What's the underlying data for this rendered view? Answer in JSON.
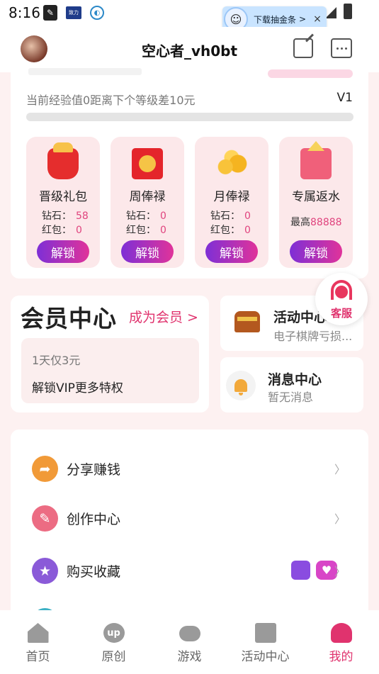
{
  "status_bar": {
    "time": "8:16",
    "app_icon_text": "致力"
  },
  "download_banner": {
    "text": "下载抽金条",
    "arrow": ">",
    "close": "×"
  },
  "header": {
    "username": "空心者_vh0bt"
  },
  "level": {
    "exp_text": "当前经验值0距离下个等级差10元",
    "level_tag": "V1",
    "progress": 0
  },
  "benefits": [
    {
      "title": "晋级礼包",
      "diamond_label": "钻石：",
      "diamond_value": "58",
      "redpack_label": "红包：",
      "redpack_value": "0",
      "button": "解锁"
    },
    {
      "title": "周俸禄",
      "diamond_label": "钻石：",
      "diamond_value": "0",
      "redpack_label": "红包：",
      "redpack_value": "0",
      "button": "解锁"
    },
    {
      "title": "月俸禄",
      "diamond_label": "钻石：",
      "diamond_value": "0",
      "redpack_label": "红包：",
      "redpack_value": "0",
      "button": "解锁"
    },
    {
      "title": "专属返水",
      "max_label": "最高",
      "max_value": "88888",
      "button": "解锁"
    }
  ],
  "customer_service": {
    "label": "客服"
  },
  "member": {
    "title": "会员中心",
    "link": "成为会员 >",
    "price": "1天仅3元",
    "desc": "解锁VIP更多特权"
  },
  "activity": {
    "title": "活动中心",
    "subtitle": "电子棋牌亏损..."
  },
  "message": {
    "title": "消息中心",
    "subtitle": "暂无消息"
  },
  "menu": [
    {
      "label": "分享赚钱",
      "arrow": "〉"
    },
    {
      "label": "创作中心",
      "arrow": "〉"
    },
    {
      "label": "购买收藏",
      "arrow": "〉"
    }
  ],
  "tabs": [
    {
      "label": "首页"
    },
    {
      "label": "原创",
      "icon_text": "up"
    },
    {
      "label": "游戏"
    },
    {
      "label": "活动中心"
    },
    {
      "label": "我的"
    }
  ],
  "colors": {
    "accent": "#e0336e",
    "button_gradient_start": "#7e2fd6",
    "button_gradient_end": "#e0339a",
    "background": "#fdf1f1"
  }
}
